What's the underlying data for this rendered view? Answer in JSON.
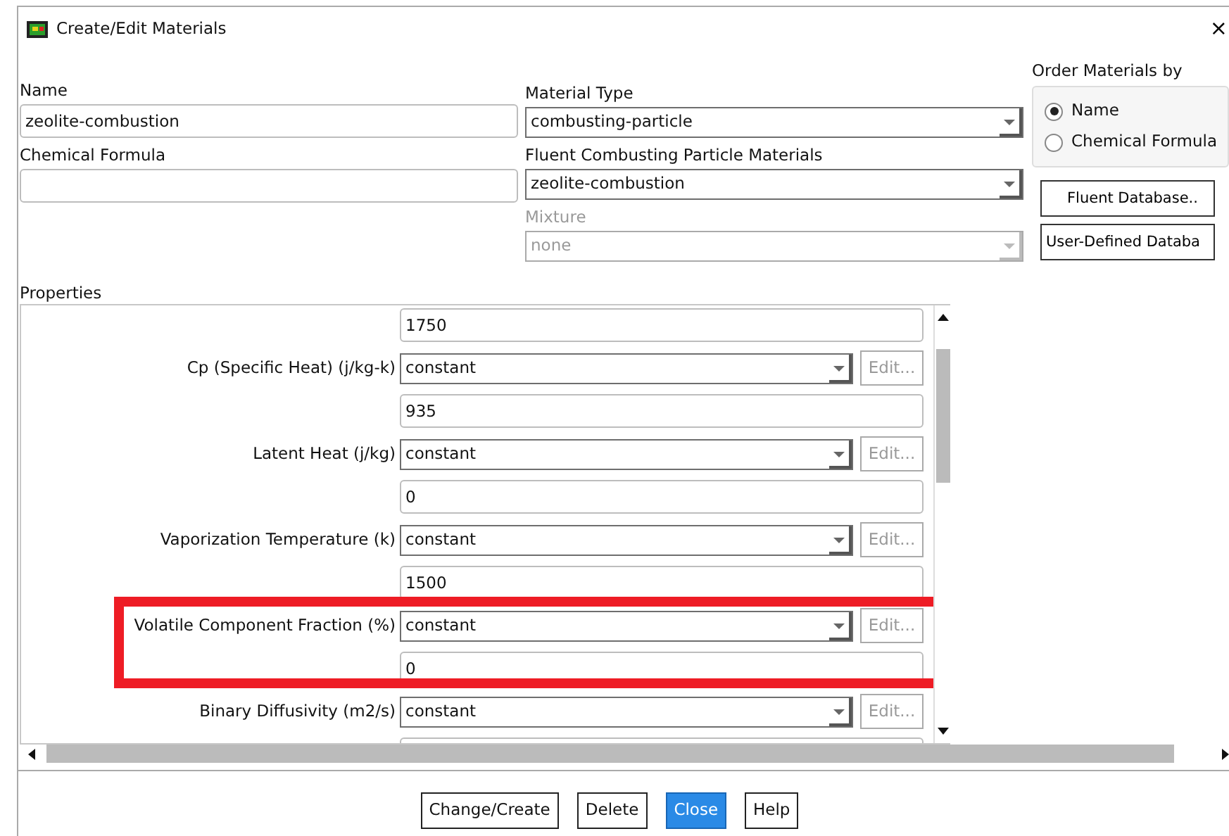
{
  "window": {
    "title": "Create/Edit Materials",
    "close": "×"
  },
  "name": {
    "label": "Name",
    "value": "zeolite-combustion"
  },
  "chemical_formula": {
    "label": "Chemical Formula"
  },
  "material_type": {
    "label": "Material Type",
    "value": "combusting-particle",
    "disabled": false
  },
  "fluent_materials": {
    "label": "Fluent Combusting Particle Materials",
    "value": "zeolite-combustion",
    "disabled": false
  },
  "mixture": {
    "label": "Mixture",
    "value": "none",
    "disabled": true
  },
  "order_by": {
    "label": "Order Materials by",
    "options": [
      {
        "label": "Name",
        "selected": true
      },
      {
        "label": "Chemical Formula",
        "selected": false
      }
    ]
  },
  "database_buttons": [
    "Fluent Database..",
    "User-Defined Databa"
  ],
  "properties": {
    "label": "Properties",
    "rows": [
      {
        "value": "1750",
        "highlighted": false
      },
      {
        "label": "Cp (Specific Heat) (j/kg-k)",
        "method": "constant",
        "edit": "Edit...",
        "edit_disabled": true,
        "value": "935",
        "highlighted": false
      },
      {
        "label": "Latent Heat (j/kg)",
        "method": "constant",
        "edit": "Edit...",
        "edit_disabled": true,
        "value": "0",
        "highlighted": false
      },
      {
        "label": "Vaporization Temperature (k)",
        "method": "constant",
        "edit": "Edit...",
        "edit_disabled": true,
        "value": "1500",
        "highlighted": false
      },
      {
        "label": "Volatile Component Fraction (%)",
        "method": "constant",
        "edit": "Edit...",
        "edit_disabled": true,
        "value": "0",
        "highlighted": true
      },
      {
        "label": "Binary Diffusivity (m2/s)",
        "method": "constant",
        "edit": "Edit...",
        "edit_disabled": true,
        "highlighted": false
      }
    ]
  },
  "buttons": [
    {
      "label": "Change/Create",
      "primary": false
    },
    {
      "label": "Delete",
      "primary": false
    },
    {
      "label": "Close",
      "primary": true
    },
    {
      "label": "Help",
      "primary": false
    }
  ]
}
